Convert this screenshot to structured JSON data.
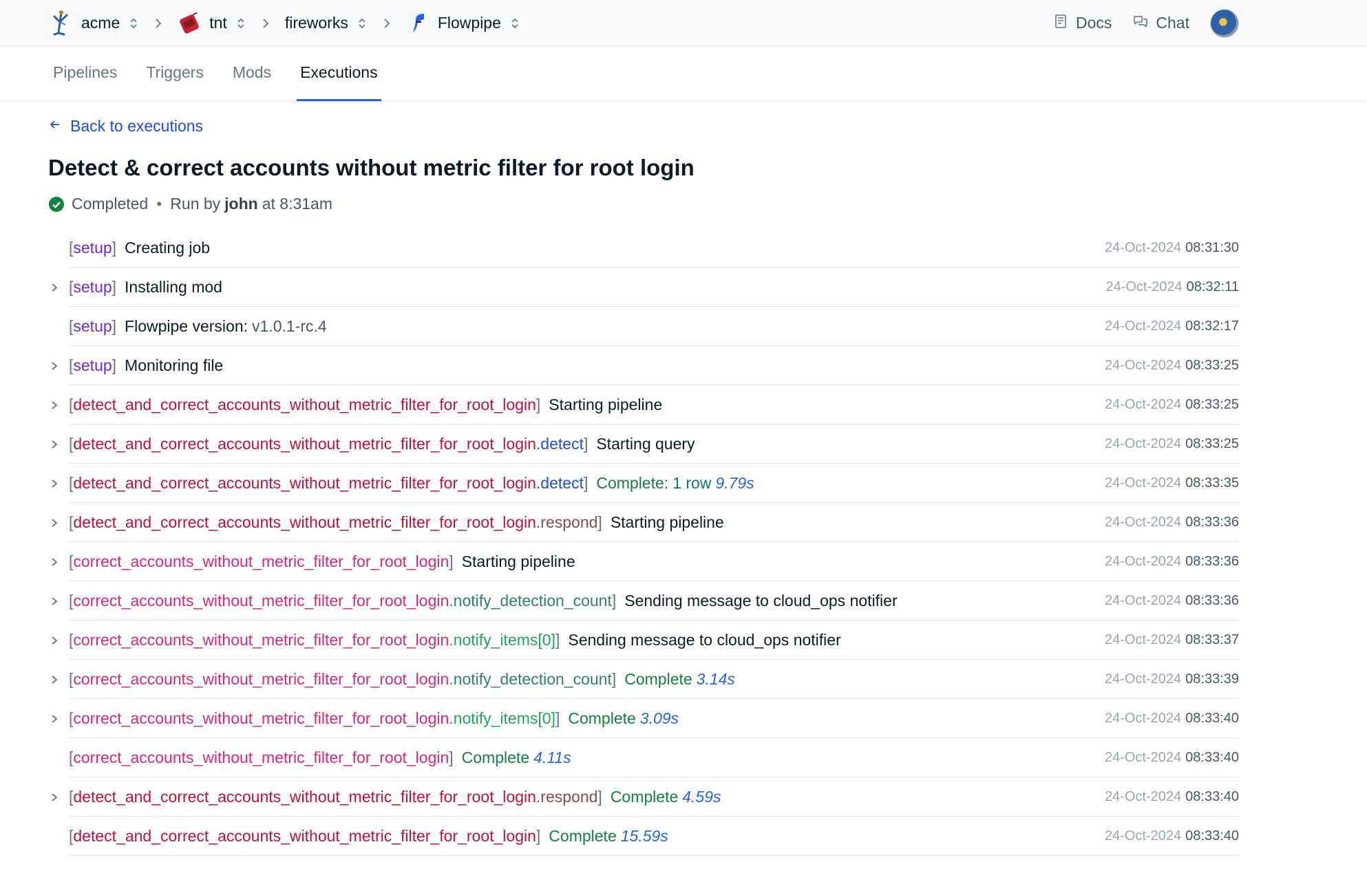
{
  "breadcrumbs": [
    {
      "label": "acme",
      "icon": "acme-logo-icon"
    },
    {
      "label": "tnt",
      "icon": "tnt-logo-icon"
    },
    {
      "label": "fireworks",
      "icon": ""
    },
    {
      "label": "Flowpipe",
      "icon": "flowpipe-logo-icon"
    }
  ],
  "header": {
    "docs_label": "Docs",
    "chat_label": "Chat"
  },
  "tabs": [
    {
      "label": "Pipelines"
    },
    {
      "label": "Triggers"
    },
    {
      "label": "Mods"
    },
    {
      "label": "Executions"
    }
  ],
  "back_label": "Back to executions",
  "title": "Detect & correct accounts without metric filter for root login",
  "meta": {
    "status": "Completed",
    "dot": "•",
    "run_by_prefix": "Run by",
    "user": "john",
    "at_time": "at 8:31am"
  },
  "brackets": {
    "open": "[",
    "close": "]"
  },
  "log": [
    {
      "expandable": false,
      "tag": "setup",
      "message": "Creating job",
      "date": "24-Oct-2024",
      "time": "08:31:30"
    },
    {
      "expandable": true,
      "tag": "setup",
      "message": "Installing mod",
      "date": "24-Oct-2024",
      "time": "08:32:11"
    },
    {
      "expandable": false,
      "tag": "setup",
      "message": "Flowpipe version:",
      "version": "v1.0.1-rc.4",
      "date": "24-Oct-2024",
      "time": "08:32:17"
    },
    {
      "expandable": true,
      "tag": "setup",
      "message": "Monitoring file",
      "date": "24-Oct-2024",
      "time": "08:33:25"
    },
    {
      "expandable": true,
      "tag": "detect_and_correct_accounts_without_metric_filter_for_root_login",
      "message": "Starting pipeline",
      "date": "24-Oct-2024",
      "time": "08:33:25"
    },
    {
      "expandable": true,
      "tag": "detect_and_correct_accounts_without_metric_filter_for_root_login",
      "sep": ".",
      "step": "detect",
      "message": "Starting query",
      "date": "24-Oct-2024",
      "time": "08:33:25"
    },
    {
      "expandable": true,
      "tag": "detect_and_correct_accounts_without_metric_filter_for_root_login",
      "sep": ".",
      "step": "detect",
      "complete": "Complete:",
      "rows": "1 row",
      "duration": "9.79s",
      "date": "24-Oct-2024",
      "time": "08:33:35"
    },
    {
      "expandable": true,
      "tag": "detect_and_correct_accounts_without_metric_filter_for_root_login",
      "sep": ".",
      "step": "respond",
      "message": "Starting pipeline",
      "date": "24-Oct-2024",
      "time": "08:33:36"
    },
    {
      "expandable": true,
      "tag": "correct_accounts_without_metric_filter_for_root_login",
      "message": "Starting pipeline",
      "date": "24-Oct-2024",
      "time": "08:33:36"
    },
    {
      "expandable": true,
      "tag": "correct_accounts_without_metric_filter_for_root_login",
      "sep": ".",
      "step": "notify_detection_count",
      "message": "Sending message to cloud_ops notifier",
      "date": "24-Oct-2024",
      "time": "08:33:36"
    },
    {
      "expandable": true,
      "tag": "correct_accounts_without_metric_filter_for_root_login",
      "sep": ".",
      "step": "notify_items[0]",
      "message": "Sending message to cloud_ops notifier",
      "date": "24-Oct-2024",
      "time": "08:33:37"
    },
    {
      "expandable": true,
      "tag": "correct_accounts_without_metric_filter_for_root_login",
      "sep": ".",
      "step": "notify_detection_count",
      "complete": "Complete",
      "duration": "3.14s",
      "date": "24-Oct-2024",
      "time": "08:33:39"
    },
    {
      "expandable": true,
      "tag": "correct_accounts_without_metric_filter_for_root_login",
      "sep": ".",
      "step": "notify_items[0]",
      "complete": "Complete",
      "duration": "3.09s",
      "date": "24-Oct-2024",
      "time": "08:33:40"
    },
    {
      "expandable": false,
      "tag": "correct_accounts_without_metric_filter_for_root_login",
      "complete": "Complete",
      "duration": "4.11s",
      "date": "24-Oct-2024",
      "time": "08:33:40"
    },
    {
      "expandable": true,
      "tag": "detect_and_correct_accounts_without_metric_filter_for_root_login",
      "sep": ".",
      "step": "respond",
      "complete": "Complete",
      "duration": "4.59s",
      "date": "24-Oct-2024",
      "time": "08:33:40"
    },
    {
      "expandable": false,
      "tag": "detect_and_correct_accounts_without_metric_filter_for_root_login",
      "complete": "Complete",
      "duration": "15.59s",
      "date": "24-Oct-2024",
      "time": "08:33:40"
    }
  ],
  "colors": {
    "accent": "#2563eb",
    "link": "#1d4ed8",
    "setup": "#6d28d9",
    "pipeline_detect": "#be123c",
    "pipeline_correct": "#db2777",
    "complete": "#15803d",
    "status_ok": "#15803d"
  }
}
